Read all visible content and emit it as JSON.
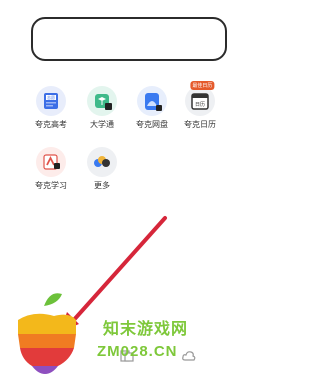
{
  "apps": [
    {
      "label": "夸克高考",
      "icon": "gaokao-icon",
      "text": "志愿"
    },
    {
      "label": "大学通",
      "icon": "university-icon"
    },
    {
      "label": "夸克网盘",
      "icon": "cloud-drive-icon"
    },
    {
      "label": "夸克日历",
      "icon": "calendar-icon",
      "badge": "最佳日历",
      "text": "日历"
    },
    {
      "label": "夸克学习",
      "icon": "study-icon"
    },
    {
      "label": "更多",
      "icon": "more-icon"
    }
  ],
  "watermark": {
    "brand": "知末游戏网",
    "domain": "ZM028.CN"
  },
  "colors": {
    "annotation_arrow": "#d6263a",
    "watermark": "#7ec83a"
  }
}
